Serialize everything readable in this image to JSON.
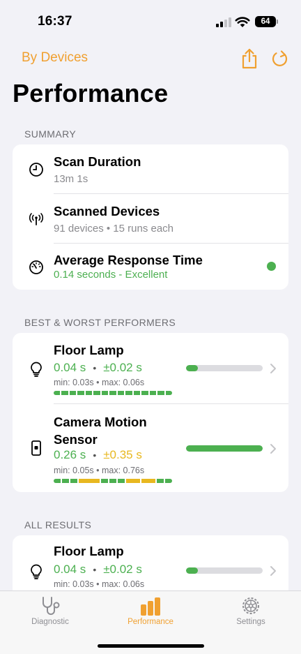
{
  "status_bar": {
    "time": "16:37",
    "battery": "64"
  },
  "nav": {
    "back_label": "By Devices",
    "title": "Performance"
  },
  "summary": {
    "header": "SUMMARY",
    "items": [
      {
        "title": "Scan Duration",
        "subtitle": "13m 1s",
        "icon": "clock-icon"
      },
      {
        "title": "Scanned Devices",
        "subtitle": "91 devices • 15 runs each",
        "icon": "antenna-icon"
      },
      {
        "title": "Average Response Time",
        "subtitle": "0.14 seconds - Excellent",
        "icon": "gauge-icon",
        "status_color": "#4cb050"
      }
    ]
  },
  "best_worst": {
    "header": "BEST & WORST PERFORMERS",
    "items": [
      {
        "name": "Floor Lamp",
        "value": "0.04 s",
        "deviation": "±0.02 s",
        "value_color": "green",
        "deviation_color": "green",
        "minmax": "min: 0.03s • max: 0.06s",
        "bar_fraction": 0.15,
        "icon": "lightbulb-icon"
      },
      {
        "name": "Camera Motion Sensor",
        "value": "0.26 s",
        "deviation": "±0.35 s",
        "value_color": "green",
        "deviation_color": "yellow",
        "minmax": "min: 0.05s • max: 0.76s",
        "bar_fraction": 1.0,
        "icon": "sensor-icon"
      }
    ]
  },
  "all_results": {
    "header": "ALL RESULTS",
    "items": [
      {
        "name": "Floor Lamp",
        "value": "0.04 s",
        "deviation": "±0.02 s",
        "minmax": "min: 0.03s • max: 0.06s",
        "bar_fraction": 0.15,
        "icon": "lightbulb-icon"
      }
    ]
  },
  "tabs": [
    {
      "label": "Diagnostic",
      "icon": "stethoscope-icon",
      "active": false
    },
    {
      "label": "Performance",
      "icon": "bar-chart-icon",
      "active": true
    },
    {
      "label": "Settings",
      "icon": "gear-icon",
      "active": false
    }
  ],
  "colors": {
    "accent": "#f0a030",
    "good": "#4cb050",
    "warn": "#e8b820",
    "background": "#f2f2f7"
  }
}
